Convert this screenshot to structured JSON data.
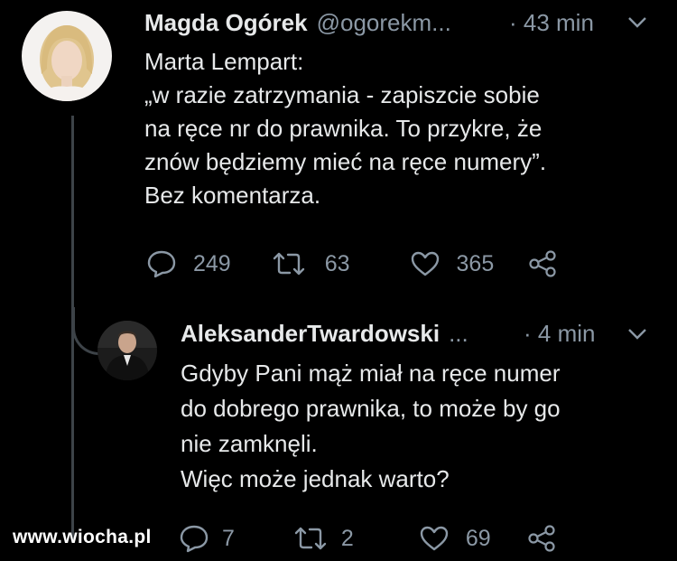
{
  "tweet1": {
    "author_name": "Magda Ogórek",
    "author_handle": "@ogorekm...",
    "time": "· 43 min",
    "body_lines": [
      "Marta Lempart:",
      "„w razie zatrzymania - zapiszcie sobie",
      "na ręce nr do prawnika. To przykre, że",
      "znów będziemy mieć na ręce numery”.",
      "Bez komentarza."
    ],
    "replies": "249",
    "retweets": "63",
    "likes": "365"
  },
  "tweet2": {
    "author_name": "AleksanderTwardowski",
    "author_handle": "...",
    "time": "· 4 min",
    "body_lines": [
      "Gdyby Pani mąż miał na ręce numer",
      "do dobrego prawnika, to może by go",
      "nie zamknęli.",
      "Więc może jednak warto?"
    ],
    "replies": "7",
    "retweets": "2",
    "likes": "69"
  },
  "watermark": "www.wiocha.pl",
  "icons": {
    "reply": "reply-icon",
    "retweet": "retweet-icon",
    "like": "heart-icon",
    "share": "share-icon",
    "menu": "chevron-down-icon"
  },
  "colors": {
    "background": "#000000",
    "text": "#e7e9ea",
    "muted": "#8b98a5"
  }
}
